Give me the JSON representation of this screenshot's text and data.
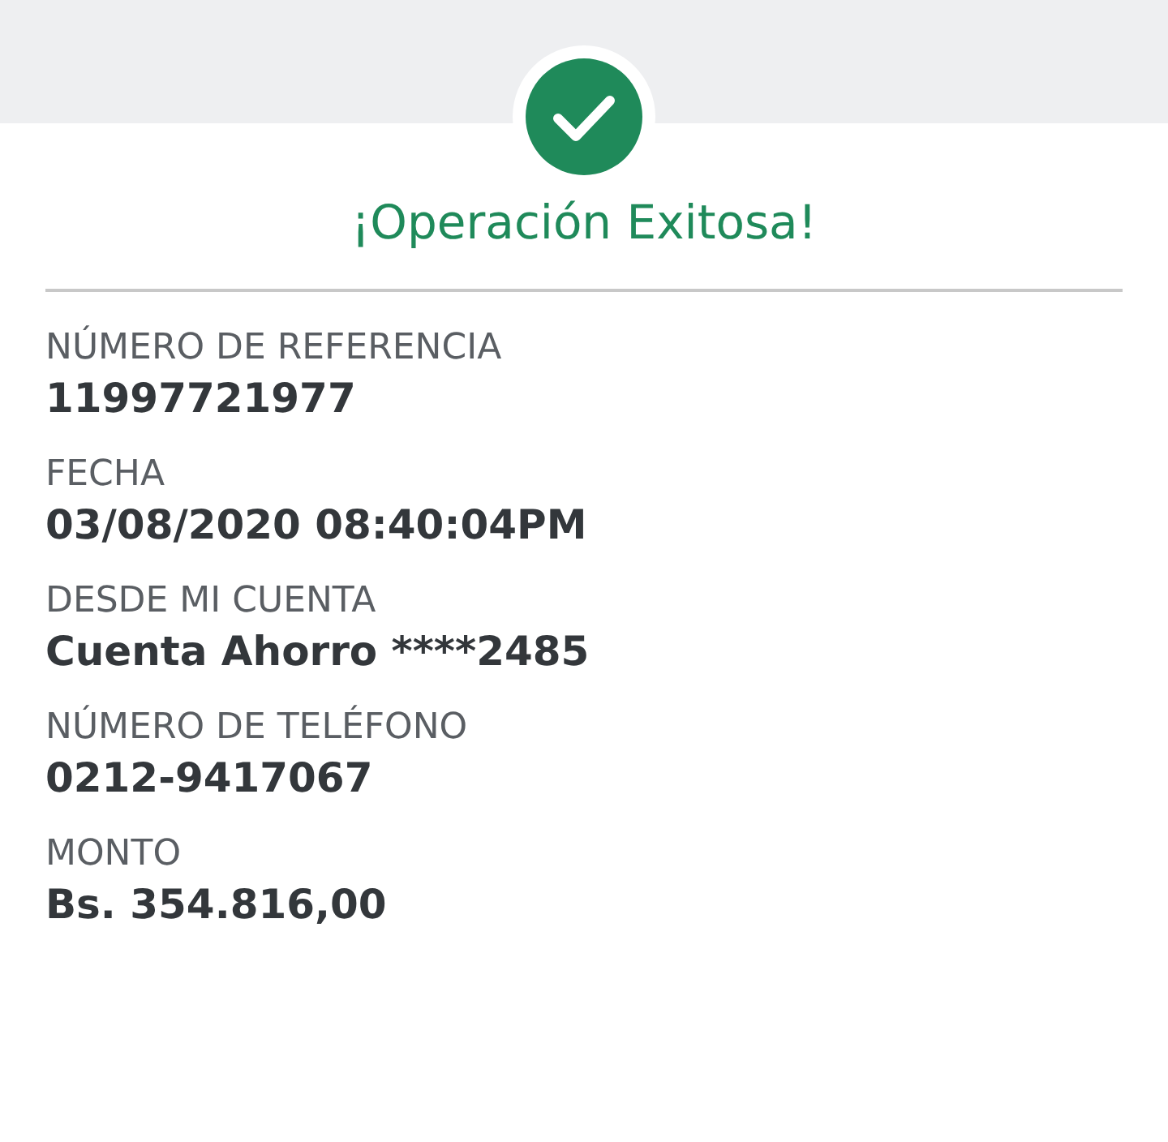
{
  "status": {
    "title": "¡Operación Exitosa!"
  },
  "fields": [
    {
      "label": "NÚMERO DE REFERENCIA",
      "value": "11997721977"
    },
    {
      "label": "FECHA",
      "value": "03/08/2020 08:40:04PM"
    },
    {
      "label": "DESDE MI CUENTA",
      "value": "Cuenta Ahorro ****2485"
    },
    {
      "label": "NÚMERO DE TELÉFONO",
      "value": "0212-9417067"
    },
    {
      "label": "MONTO",
      "value": "Bs. 354.816,00"
    }
  ]
}
